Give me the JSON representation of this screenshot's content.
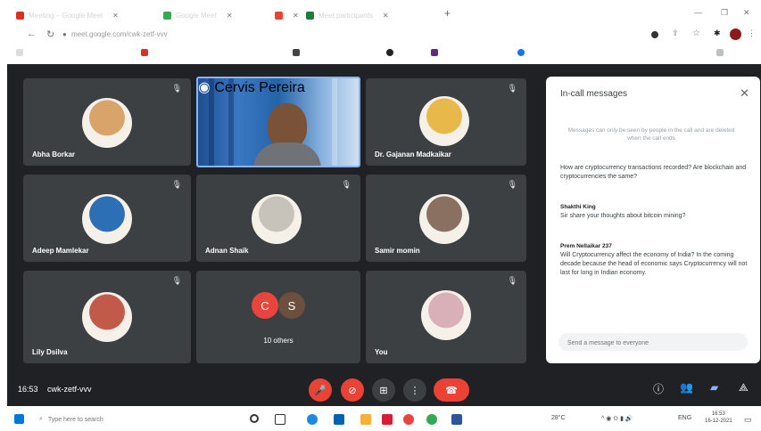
{
  "browser": {
    "tabs": [
      {
        "title": "Meeting – Google Meet",
        "color": "#d93025"
      },
      {
        "title": "Google Meet",
        "color": "#34a853"
      },
      {
        "title": "",
        "color": "#ea4335"
      },
      {
        "title": "Meet participants",
        "color": "#188038"
      }
    ],
    "url": "meet.google.com/cwk-zetf-vvv"
  },
  "participants": [
    {
      "name": "Abha Borkar",
      "color": "#d8a46a"
    },
    {
      "name": "Cervis Pereira",
      "color": "#7a5238"
    },
    {
      "name": "Dr. Gajanan Madkaikar",
      "color": "#e8b84a"
    },
    {
      "name": "Adeep Mamlekar",
      "color": "#2d6fb5"
    },
    {
      "name": "Adnan Shaik",
      "color": "#c7c2ba"
    },
    {
      "name": "Samir momin",
      "color": "#8a7060"
    },
    {
      "name": "Lily Dsilva",
      "color": "#c25a4a"
    },
    {
      "name": "You",
      "color": "#d9b0b8"
    }
  ],
  "others": {
    "label": "10 others",
    "initials": [
      "C",
      "S"
    ],
    "colors": [
      "#e8453c",
      "#6b4f3f"
    ]
  },
  "chat": {
    "title": "In-call messages",
    "note": "Messages can only be seen by people in the call and are deleted when the call ends",
    "messages": [
      {
        "sender": "",
        "text": "How are cryptocurrency transactions recorded? Are blockchain and cryptocurrencies the same?"
      },
      {
        "sender": "Shakthi King",
        "text": "Sir share your thoughts about bitcoin mining?"
      },
      {
        "sender": "Prem Nellaikar 237",
        "text": "Will Cryptocurrency affect the economy of India? In the coming decade because the head of economic says Cryptocurrency will not last for long in Indian economy."
      }
    ],
    "input_placeholder": "Send a message to everyone"
  },
  "meeting": {
    "time": "16:53",
    "code": "cwk-zetf-vvv"
  },
  "taskbar": {
    "search_placeholder": "Type here to search",
    "temperature": "28°C",
    "language": "ENG",
    "clock": "16:53",
    "date": "16-12-2021"
  }
}
